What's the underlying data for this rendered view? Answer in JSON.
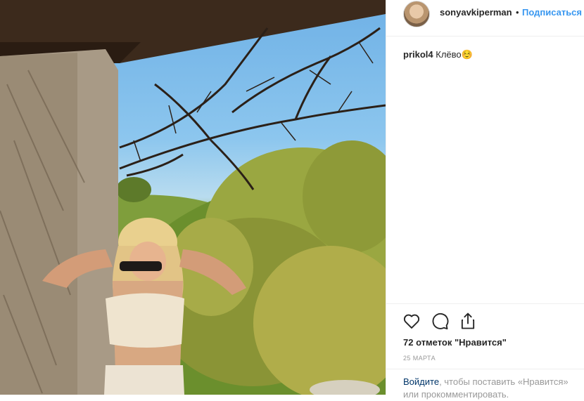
{
  "post": {
    "username": "sonyavkiperman",
    "dot": "•",
    "follow_label": "Подписаться",
    "comment_user": "prikol4",
    "comment_text": "Клёво☺️",
    "likes_text": "72 отметок \"Нравится\"",
    "date_text": "25 МАРТА"
  },
  "footer": {
    "login_link": "Войдите",
    "rest_text": ", чтобы поставить «Нравится» или прокомментировать."
  },
  "icons": {
    "like": "heart-icon",
    "comment": "comment-icon",
    "share": "share-icon"
  },
  "colors": {
    "accent": "#3897f0",
    "text": "#262626",
    "muted": "#999999"
  }
}
